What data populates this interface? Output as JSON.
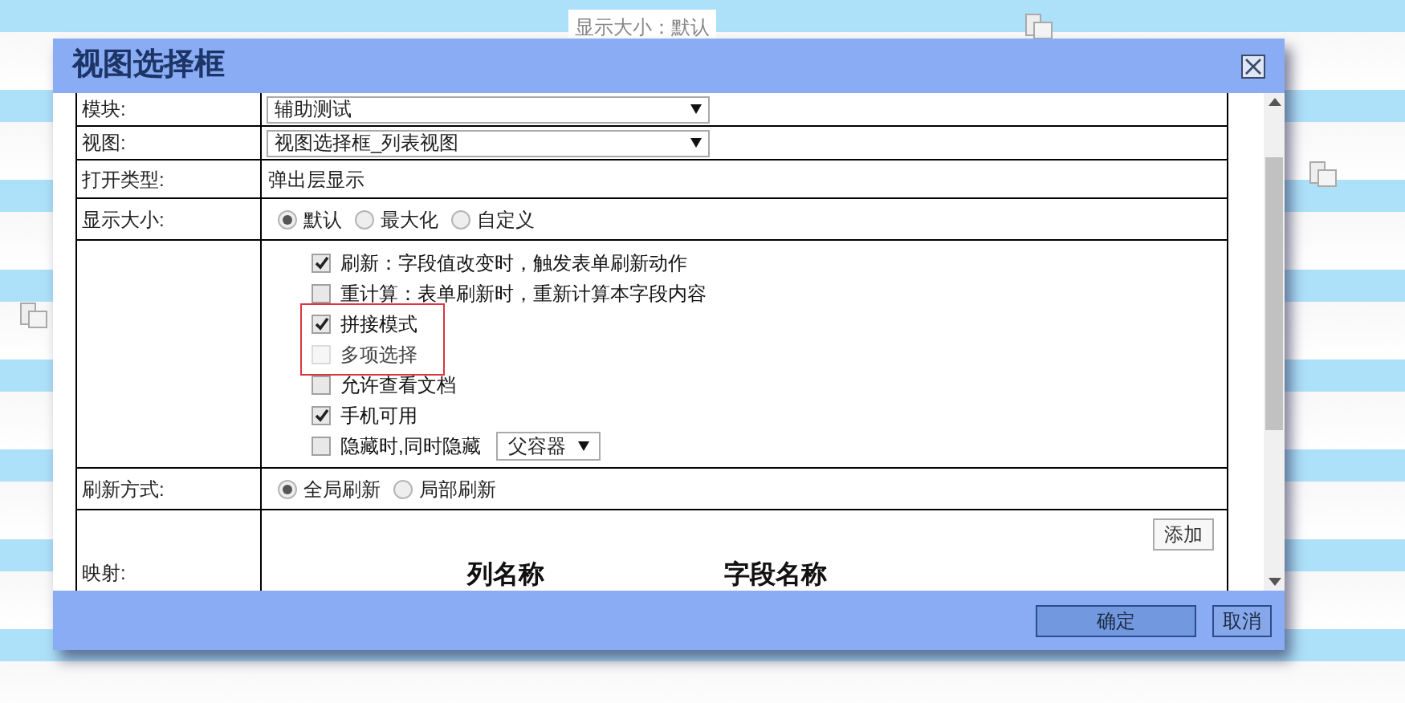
{
  "background": {
    "label": "显示大小：默认"
  },
  "dialog": {
    "title": "视图选择框",
    "rows": [
      {
        "kind": "select",
        "label": "模块:",
        "value": "辅助测试"
      },
      {
        "kind": "select",
        "label": "视图:",
        "value": "视图选择框_列表视图"
      },
      {
        "kind": "text",
        "label": "打开类型:",
        "value": "弹出层显示"
      },
      {
        "kind": "radio",
        "label": "显示大小:",
        "options": [
          {
            "label": "默认",
            "selected": true
          },
          {
            "label": "最大化",
            "selected": false
          },
          {
            "label": "自定义",
            "selected": false
          }
        ]
      },
      {
        "kind": "checks",
        "options": [
          {
            "label": "刷新：字段值改变时，触发表单刷新动作",
            "checked": true,
            "disabled": false,
            "highlighted": false
          },
          {
            "label": "重计算：表单刷新时，重新计算本字段内容",
            "checked": false,
            "disabled": false,
            "highlighted": false
          },
          {
            "label": "拼接模式",
            "checked": true,
            "disabled": false,
            "highlighted": true
          },
          {
            "label": "多项选择",
            "checked": false,
            "disabled": true,
            "highlighted": true
          },
          {
            "label": "允许查看文档",
            "checked": false,
            "disabled": false,
            "highlighted": false
          },
          {
            "label": "手机可用",
            "checked": true,
            "disabled": false,
            "highlighted": false
          },
          {
            "label": "隐藏时,同时隐藏",
            "checked": false,
            "disabled": false,
            "highlighted": false,
            "select": "父容器"
          }
        ]
      },
      {
        "kind": "radio",
        "label": "刷新方式:",
        "options": [
          {
            "label": "全局刷新",
            "selected": true
          },
          {
            "label": "局部刷新",
            "selected": false
          }
        ]
      },
      {
        "kind": "mapping",
        "label": "映射:",
        "add_button": "添加",
        "columns": [
          "列名称",
          "字段名称"
        ]
      }
    ],
    "buttons": [
      {
        "label": "确定",
        "primary": true
      },
      {
        "label": "取消",
        "primary": false
      }
    ]
  }
}
